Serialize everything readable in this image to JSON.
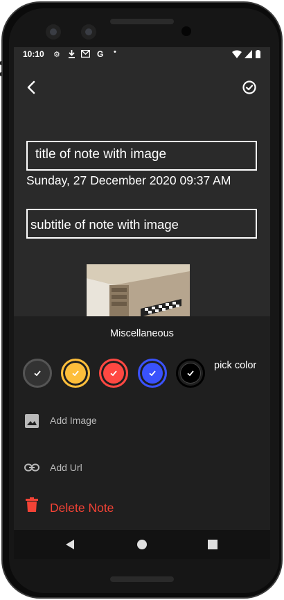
{
  "status_bar": {
    "time": "10:10",
    "left_icons": [
      "gear-icon",
      "download-icon",
      "gmail-icon",
      "google-g-icon",
      "dot-icon"
    ],
    "right_icons": [
      "wifi-icon",
      "signal-icon",
      "battery-icon"
    ]
  },
  "toolbar": {
    "back_icon": "back-icon",
    "save_icon": "check-circle-icon"
  },
  "note": {
    "title": "title of note with image",
    "date": "Sunday, 27 December 2020 09:37 AM",
    "subtitle": "subtitle of note with image"
  },
  "misc_sheet": {
    "title": "Miscellaneous",
    "pick_color_label": "pick color",
    "colors": [
      {
        "name": "default",
        "fill": "#333333",
        "ring": "#555555",
        "selected": true
      },
      {
        "name": "yellow",
        "fill": "#fdbe3b",
        "ring": "#fdbe3b",
        "selected": true
      },
      {
        "name": "red",
        "fill": "#ff4842",
        "ring": "#ff4842",
        "selected": true
      },
      {
        "name": "blue",
        "fill": "#3a52fc",
        "ring": "#3a52fc",
        "selected": true
      },
      {
        "name": "black",
        "fill": "#000000",
        "ring": "#000000",
        "selected": true
      }
    ],
    "add_image_label": "Add Image",
    "add_url_label": "Add Url",
    "delete_label": "Delete Note"
  },
  "colors": {
    "background": "#2a2a2a",
    "sheet": "#1f1f1f",
    "delete": "#f44336"
  }
}
